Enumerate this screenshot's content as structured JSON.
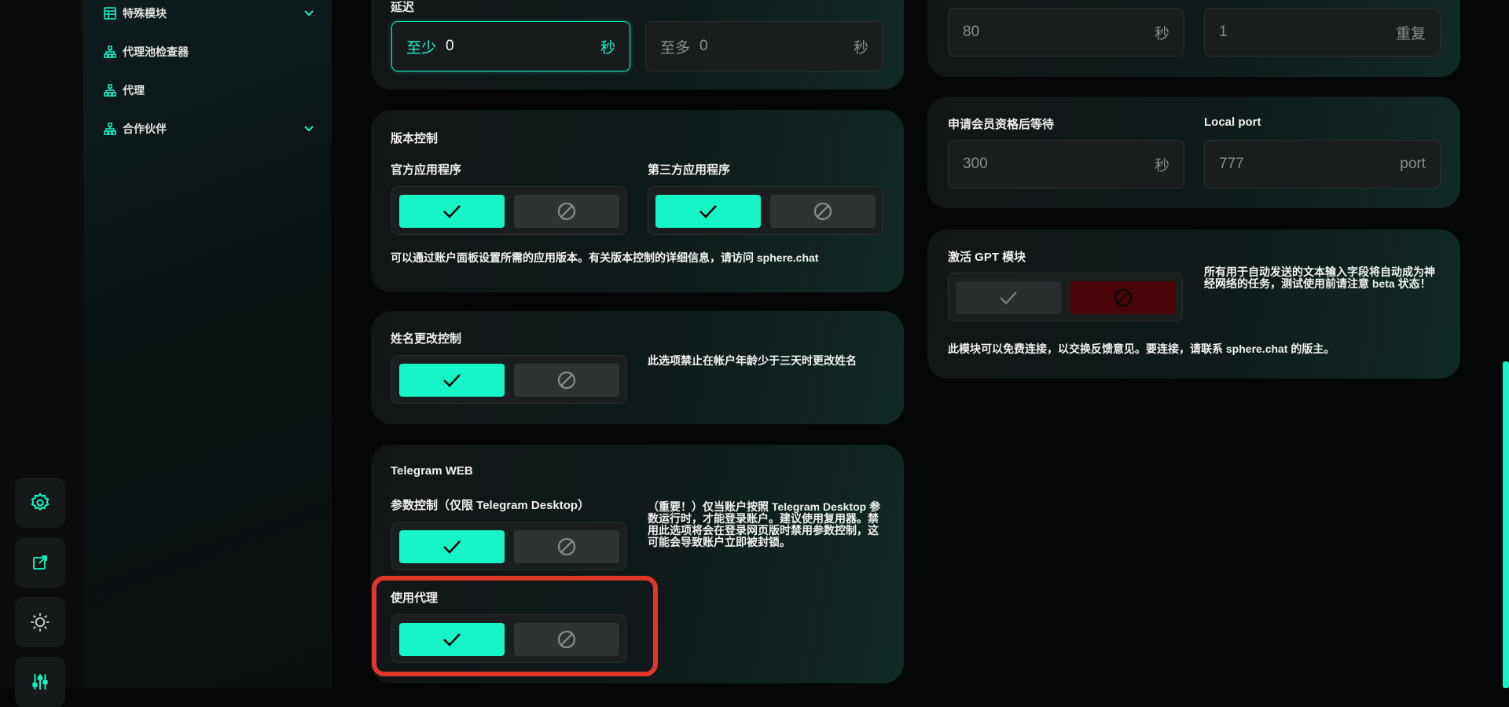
{
  "sidebar": {
    "items": [
      {
        "label": "特殊模块",
        "icon": "table-icon",
        "expandable": true
      },
      {
        "label": "代理池检查器",
        "icon": "network-icon",
        "expandable": false
      },
      {
        "label": "代理",
        "icon": "network-icon",
        "expandable": false
      },
      {
        "label": "合作伙伴",
        "icon": "network-icon",
        "expandable": true
      }
    ]
  },
  "rail": {
    "buttons": [
      "gear-icon",
      "external-link-icon",
      "theme-toggle-icon",
      "sliders-icon"
    ]
  },
  "delay": {
    "title": "延迟",
    "min_prefix": "至少",
    "min_value": "0",
    "min_unit": "秒",
    "max_prefix": "至多",
    "max_placeholder": "0",
    "max_unit": "秒"
  },
  "version_control": {
    "title": "版本控制",
    "official_label": "官方应用程序",
    "third_party_label": "第三方应用程序",
    "note": "可以通过账户面板设置所需的应用版本。有关版本控制的详细信息，请访问 sphere.chat"
  },
  "name_change": {
    "title": "姓名更改控制",
    "note": "此选项禁止在帐户年龄少于三天时更改姓名"
  },
  "telegram_web": {
    "title": "Telegram WEB",
    "param_label": "参数控制（仅限 Telegram Desktop）",
    "note": "（重要！）仅当账户按照 Telegram Desktop 参数运行时，才能登录账户。建议使用复用器。禁用此选项将会在登录网页版时禁用参数控制，这可能会导致账户立即被封锁。",
    "proxy_label": "使用代理"
  },
  "top_right": {
    "field1_placeholder": "80",
    "field1_unit": "秒",
    "field2_placeholder": "1",
    "field2_unit": "重复"
  },
  "membership": {
    "wait_label": "申请会员资格后等待",
    "wait_placeholder": "300",
    "wait_unit": "秒",
    "port_label": "Local port",
    "port_placeholder": "777",
    "port_unit": "port"
  },
  "gpt": {
    "title": "激活 GPT 模块",
    "side_note": "所有用于自动发送的文本输入字段将自动成为神经网络的任务，测试使用前请注意 beta 状态！",
    "note": "此模块可以免费连接，以交换反馈意见。要连接，请联系 sphere.chat 的版主。"
  },
  "colors": {
    "accent": "#16f5c8",
    "danger_off": "#4a0509",
    "highlight": "#e0372c"
  }
}
